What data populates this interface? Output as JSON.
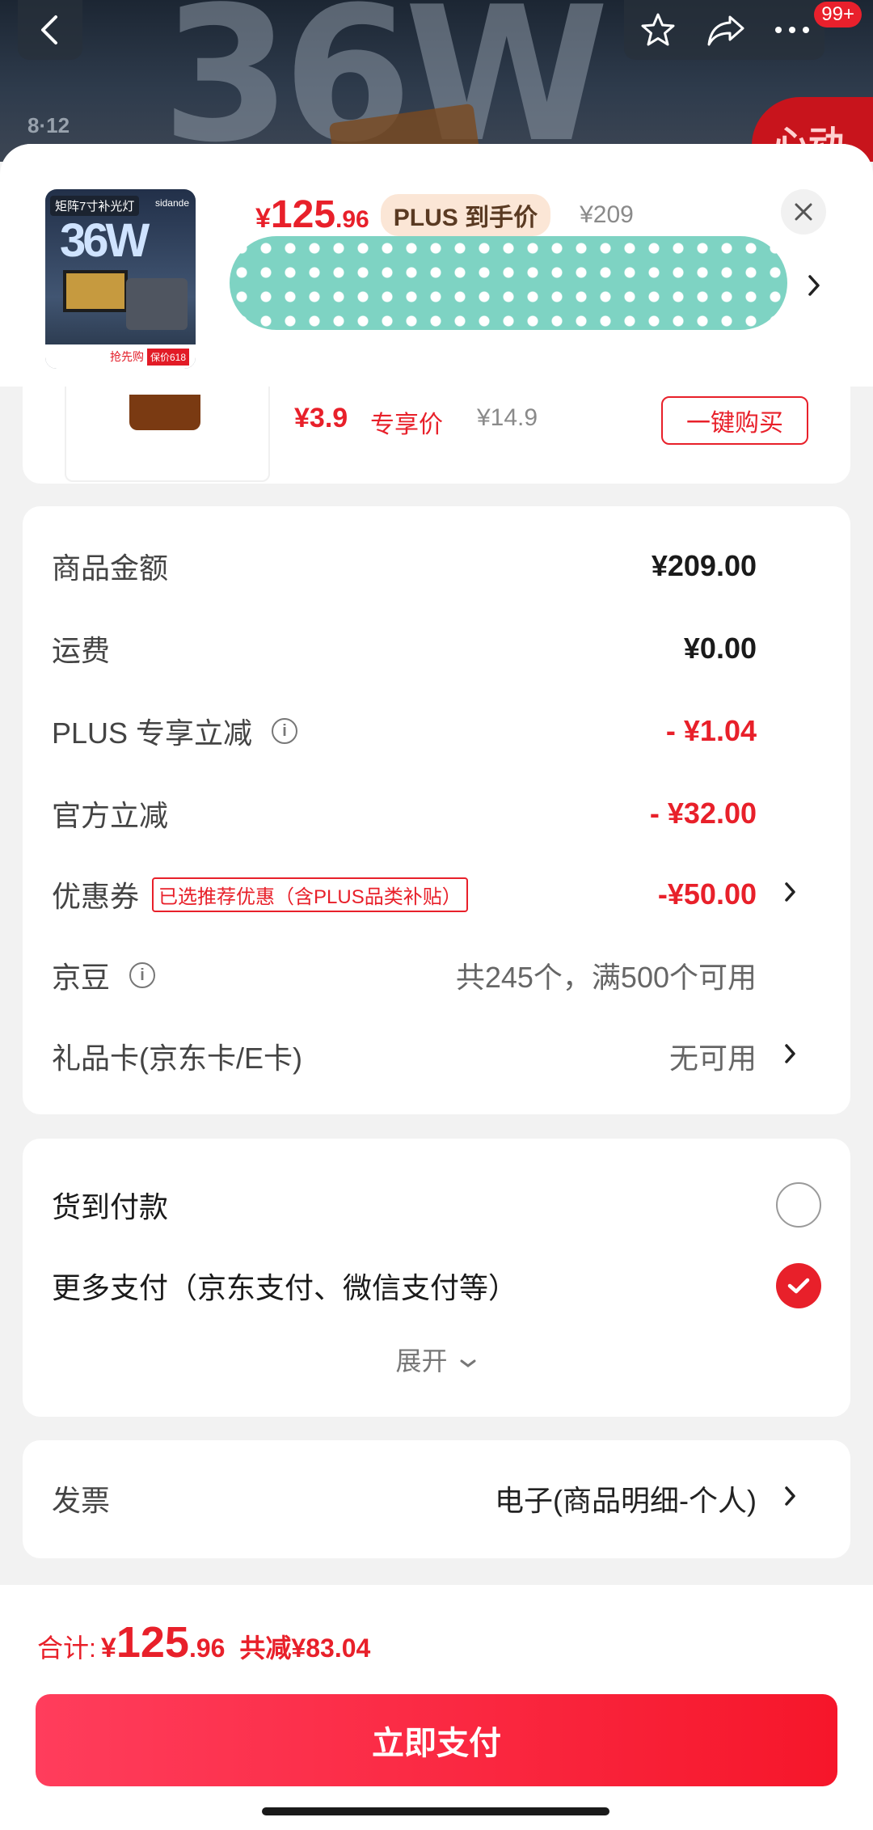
{
  "header": {
    "banner_text": "36W",
    "banner_date": "8·12",
    "banner_promo": "心动",
    "notification_count": "99+"
  },
  "product": {
    "thumb_title": "矩阵7寸补光灯",
    "thumb_brand": "sidande",
    "thumb_big": "36W",
    "thumb_badge1": "抢先购",
    "thumb_badge2": "保价618",
    "price_yen": "¥",
    "price_int": "125",
    "price_dec": ".96",
    "plus_tag": "PLUS 到手价",
    "original_price": "¥209"
  },
  "prev_item": {
    "price": "¥3.9",
    "price_label": "专享价",
    "orig_price": "¥14.9",
    "buy_label": "一键购买"
  },
  "details": [
    {
      "label": "商品金额",
      "value": "¥209.00"
    },
    {
      "label": "运费",
      "value": "¥0.00"
    },
    {
      "label": "PLUS 专享立减",
      "value": "- ¥1.04"
    },
    {
      "label": "官方立减",
      "value": "- ¥32.00"
    },
    {
      "label": "优惠券",
      "tag": "已选推荐优惠（含PLUS品类补贴）",
      "value": "-¥50.00"
    },
    {
      "label": "京豆",
      "value": "共245个，满500个可用"
    },
    {
      "label": "礼品卡(京东卡/E卡)",
      "value": "无可用"
    }
  ],
  "payment": {
    "cod": "货到付款",
    "more": "更多支付（京东支付、微信支付等）",
    "expand": "展开"
  },
  "invoice": {
    "label": "发票",
    "value": "电子(商品明细-个人)"
  },
  "footer": {
    "total_label": "合计:",
    "total_yen": "¥",
    "total_int": "125",
    "total_dec": ".96",
    "saved": "共减¥83.04",
    "pay_button": "立即支付"
  },
  "colors": {
    "accent": "#e8202a",
    "plus_tag_bg": "#fbe6d6",
    "redaction": "#7ed3c3"
  }
}
